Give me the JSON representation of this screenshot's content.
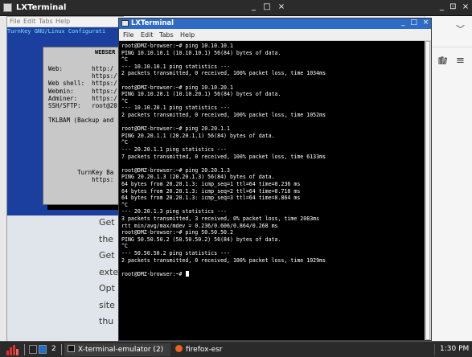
{
  "outer_window": {
    "title": "LXTerminal",
    "controls": "_ □ ×",
    "right_controls": "_ ⊡ ×"
  },
  "firefox_sidebar": {
    "chevron": "﹀",
    "library_icon": "library-icon",
    "menu_icon": "hamburger-icon"
  },
  "back_terminal": {
    "menu": [
      "File",
      "Edit",
      "Tabs",
      "Help"
    ],
    "header": "TurnKey GNU/Linux Configurati",
    "dialog_title": "WEBSER",
    "lines": [
      "Web:        http:/",
      "            https:/",
      "Web shell:  https:/",
      "Webmin:     https:/",
      "Adminer:    https:/",
      "SSH/SFTP:   root@20",
      "",
      "TKLBAM (Backup and",
      "",
      "",
      "",
      "",
      "",
      "",
      "        TurnKey Ba",
      "            https:"
    ],
    "web_words": [
      "Get",
      "the",
      "Get",
      "exte",
      "Opt",
      "site",
      "thu"
    ]
  },
  "front_terminal": {
    "title": "LXTerminal",
    "controls": "_ □ ×",
    "menu": [
      "File",
      "Edit",
      "Tabs",
      "Help"
    ],
    "lines": [
      "root@DMZ-browser:~# ping 10.10.10.1",
      "PING 10.10.10.1 (10.10.10.1) 56(84) bytes of data.",
      "^C",
      "--- 10.10.10.1 ping statistics ---",
      "2 packets transmitted, 0 received, 100% packet loss, time 1034ms",
      "",
      "root@DMZ-browser:~# ping 10.10.20.1",
      "PING 10.10.20.1 (10.10.20.1) 56(84) bytes of data.",
      "^C",
      "--- 10.10.20.1 ping statistics ---",
      "2 packets transmitted, 0 received, 100% packet loss, time 1052ms",
      "",
      "root@DMZ-browser:~# ping 20.20.1.1",
      "PING 20.20.1.1 (20.20.1.1) 56(84) bytes of data.",
      "^C",
      "--- 20.20.1.1 ping statistics ---",
      "7 packets transmitted, 0 received, 100% packet loss, time 6133ms",
      "",
      "root@DMZ-browser:~# ping 20.20.1.3",
      "PING 20.20.1.3 (20.20.1.3) 56(84) bytes of data.",
      "64 bytes from 20.20.1.3: icmp_seq=1 ttl=64 time=0.236 ms",
      "64 bytes from 20.20.1.3: icmp_seq=2 ttl=64 time=0.718 ms",
      "64 bytes from 20.20.1.3: icmp_seq=3 ttl=64 time=0.864 ms",
      "^C",
      "--- 20.20.1.3 ping statistics ---",
      "3 packets transmitted, 3 received, 0% packet loss, time 2083ms",
      "rtt min/avg/max/mdev = 0.236/0.606/0.864/0.268 ms",
      "root@DMZ-browser:~# ping 50.50.50.2",
      "PING 50.50.50.2 (50.50.50.2) 56(84) bytes of data.",
      "^C",
      "--- 50.50.50.2 ping statistics ---",
      "2 packets transmitted, 0 received, 100% packet loss, time 1029ms",
      "",
      "root@DMZ-browser:~# "
    ]
  },
  "taskbar": {
    "desktop_number": "2",
    "tasks": [
      {
        "label": "X-terminal-emulator (2)",
        "icon": "terminal-icon"
      },
      {
        "label": "firefox-esr",
        "icon": "firefox-icon"
      }
    ],
    "clock": "1:30 PM"
  },
  "colors": {
    "term_titlebar": "#2d6bc7",
    "tkl_blue": "#1a3f9e",
    "tkl_header_text": "#7ee2ff"
  }
}
